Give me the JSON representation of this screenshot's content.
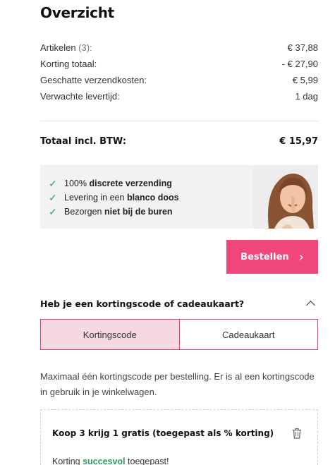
{
  "header": {
    "title": "Overzicht"
  },
  "summary": {
    "items_label": "Artikelen",
    "items_count": "(3):",
    "items_value": "€ 37,88",
    "discount_label": "Korting totaal:",
    "discount_value": "- € 27,90",
    "shipping_label": "Geschatte verzendkosten:",
    "shipping_value": "€ 5,99",
    "delivery_label": "Verwachte levertijd:",
    "delivery_value": "1 dag"
  },
  "total": {
    "label": "Totaal incl. BTW:",
    "value": "€ 15,97"
  },
  "usp": {
    "items": [
      {
        "pre": "100% ",
        "bold": "discrete verzending",
        "post": ""
      },
      {
        "pre": "Levering in een ",
        "bold": "blanco doos",
        "post": ""
      },
      {
        "pre": "Bezorgen ",
        "bold": "niet bij de buren",
        "post": ""
      }
    ]
  },
  "order_button": {
    "label": "Bestellen"
  },
  "code_section": {
    "question": "Heb je een kortingscode of cadeaukaart?",
    "tabs": [
      "Kortingscode",
      "Cadeaukaart"
    ],
    "info": "Maximaal één kortingscode per bestelling. Er is al een kortingscode in gebruik in je winkelwagen.",
    "applied_title": "Koop 3 krijg 1 gratis (toegepast als % korting)",
    "applied_pre": "Korting ",
    "applied_ok": "succesvol",
    "applied_post": " toegepast!"
  },
  "colors": {
    "accent": "#f0467a",
    "tab_active_bg": "#f6d8e1",
    "check": "#2e9b57",
    "usp_bg": "#f2f2f2"
  },
  "icons": [
    "check-icon",
    "chevron-right-icon",
    "chevron-up-icon",
    "trash-icon"
  ]
}
